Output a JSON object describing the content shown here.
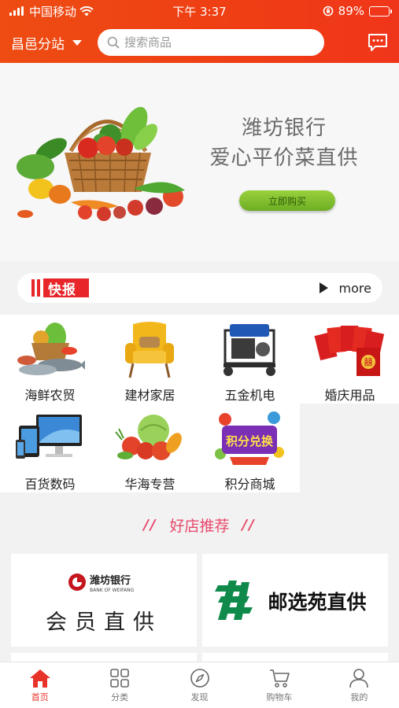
{
  "status_bar": {
    "carrier": "中国移动",
    "time": "下午 3:37",
    "battery": "89%",
    "battery_level": 0.89
  },
  "nav": {
    "city": "昌邑分站",
    "search_placeholder": "搜索商品"
  },
  "banner": {
    "line1": "潍坊银行",
    "line2": "爱心平价菜直供",
    "button": "立即购买"
  },
  "news": {
    "label": "快报",
    "more": "more"
  },
  "categories": [
    {
      "label": "海鲜农贸",
      "icon": "seafood-icon"
    },
    {
      "label": "建材家居",
      "icon": "armchair-icon"
    },
    {
      "label": "五金机电",
      "icon": "generator-icon"
    },
    {
      "label": "婚庆用品",
      "icon": "red-envelope-icon"
    },
    {
      "label": "百货数码",
      "icon": "devices-icon"
    },
    {
      "label": "华海专营",
      "icon": "vegetables-icon"
    },
    {
      "label": "积分商城",
      "icon": "points-exchange-icon"
    }
  ],
  "points_art_text": "积分兑换",
  "section": {
    "title": "好店推荐"
  },
  "shops": [
    {
      "logo_cn": "潍坊银行",
      "logo_en": "BANK OF WEIFANG",
      "name": "会员直供"
    },
    {
      "name": "邮选苑直供"
    }
  ],
  "tabs": [
    {
      "label": "首页",
      "active": true
    },
    {
      "label": "分类",
      "active": false
    },
    {
      "label": "发现",
      "active": false
    },
    {
      "label": "购物车",
      "active": false
    },
    {
      "label": "我的",
      "active": false
    }
  ],
  "colors": {
    "header": "#ef3e14",
    "accent": "#e8332a",
    "section_title": "#e8486b",
    "buy_button": "#7cbc2c"
  }
}
